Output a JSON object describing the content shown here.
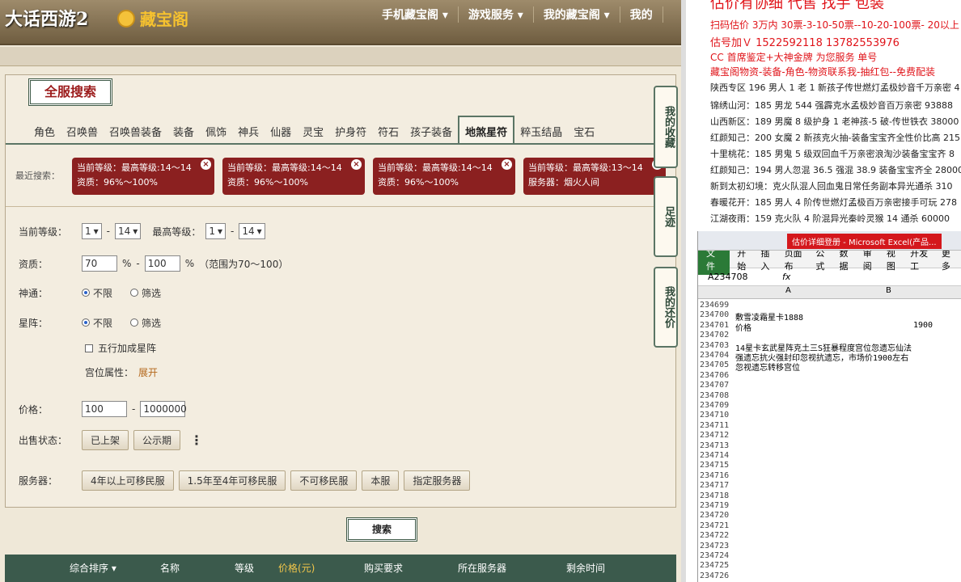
{
  "header": {
    "logo_game": "大话西游2",
    "logo_site": "藏宝阁",
    "nav": [
      "手机藏宝阁 ▾",
      "游戏服务 ▾",
      "我的藏宝阁 ▾",
      "我的"
    ]
  },
  "panel": {
    "title": "全服搜索",
    "tabs": [
      "角色",
      "召唤兽",
      "召唤兽装备",
      "装备",
      "佩饰",
      "神兵",
      "仙器",
      "灵宝",
      "护身符",
      "符石",
      "孩子装备",
      "地煞星符",
      "粹玉结晶",
      "宝石"
    ],
    "recent_label": "最近搜索：",
    "chips": [
      {
        "l1": "当前等级：最高等级:14～14",
        "l2": "资质：96%～100%"
      },
      {
        "l1": "当前等级：最高等级:14～14",
        "l2": "资质：96%～100%"
      },
      {
        "l1": "当前等级：最高等级:14～14",
        "l2": "资质：96%～100%"
      },
      {
        "l1": "当前等级：最高等级:13～14",
        "l2": "服务器：烟火人间"
      }
    ],
    "form": {
      "level_label": "当前等级：",
      "lv_min": "1",
      "lv_max": "14",
      "maxlevel_label": "最高等级：",
      "mlv_min": "1",
      "mlv_max": "14",
      "quality_label": "资质：",
      "q_min": "70",
      "q_max": "100",
      "pct": "%",
      "range_note": "（范围为70～100）",
      "shentong_label": "神通：",
      "xingzhen_label": "星阵：",
      "opt_any": "不限",
      "opt_filter": "筛选",
      "wuxing": "五行加成星阵",
      "gongwei_label": "宫位属性：",
      "expand": "展开",
      "price_label": "价格：",
      "p_min": "100",
      "p_max": "1000000",
      "sale_label": "出售状态：",
      "sale_opts": [
        "已上架",
        "公示期"
      ],
      "server_label": "服务器：",
      "server_opts": [
        "4年以上可移民服",
        "1.5年至4年可移民服",
        "不可移民服",
        "本服",
        "指定服务器"
      ]
    },
    "search": "搜索",
    "table_head": [
      "综合排序 ▾",
      "名称",
      "等级",
      "价格(元)",
      "购买要求",
      "所在服务器",
      "剩余时间"
    ]
  },
  "side_buttons": [
    "我的收藏",
    "足迹",
    "我的还价"
  ],
  "right": {
    "ads": [
      "估价有协细 代售 找手 包装",
      "扫码估价 3万内 30票-3-10-50票--10-20-100票- 20以上 150+",
      "估号加Ｖ 1522592118 13782553976",
      "CC 首席鉴定+大神金牌 为您服务 单号",
      "藏宝阁物资-装备-角色-物资联系我-抽红包--免费配装"
    ],
    "info": [
      "陕西专区 196 男人 1 老 1 新孩子传世燃灯孟极妙音千万亲密 4",
      "锦绣山河：185 男龙 544 强霹克水孟极妙音百万亲密 93888",
      "山西新区：189 男魔 8 级护身 1 老神孩-5 破-传世铁衣 38000",
      "红颜知己：200 女魔 2 新孩克火抽-装备宝宝齐全性价比高 215",
      "十里桃花：185 男鬼 5 级双回血千万亲密浪淘沙装备宝宝齐 8",
      "红颜知己：194 男人忽混 36.5 强混 38.9 装备宝宝齐全 28000",
      "新到太初幻境：克火队混人回血鬼日常任务副本异光通杀 310",
      "春暖花开：185 男人 4 阶传世燃灯孟极百万亲密接手可玩 278",
      "江湖夜雨：159 克火队 4 阶混异光秦岭灵猴 14 通杀 60000"
    ]
  },
  "excel": {
    "title": "估价详细登册 - Microsoft Excel(产品...",
    "tabs": [
      "文件",
      "开始",
      "插入",
      "页面布",
      "公式",
      "数据",
      "审阅",
      "视图",
      "开发工",
      "更多"
    ],
    "cell_ref": "A234708",
    "fx": "fx",
    "col_a": "A",
    "col_b": "B",
    "rows": [
      {
        "n": "234699",
        "a": "",
        "b": ""
      },
      {
        "n": "234700",
        "a": "敷雪凌霜星卡1888",
        "b": ""
      },
      {
        "n": "234701",
        "a": "价格",
        "b": "1900"
      },
      {
        "n": "234702",
        "a": "",
        "b": ""
      },
      {
        "n": "234703",
        "a": "14星卡玄武星阵克土三S狂暴程度宫位忽遗忘仙法",
        "b": ""
      },
      {
        "n": "234704",
        "a": "强遗忘抗火强封印忽视抗遗忘，市场价1900左右",
        "b": ""
      },
      {
        "n": "234705",
        "a": "忽视遗忘转移宫位",
        "b": ""
      },
      {
        "n": "234706",
        "a": "",
        "b": ""
      },
      {
        "n": "234707",
        "a": "",
        "b": ""
      },
      {
        "n": "234708",
        "a": "",
        "b": ""
      },
      {
        "n": "234709",
        "a": "",
        "b": ""
      },
      {
        "n": "234710",
        "a": "",
        "b": ""
      },
      {
        "n": "234711",
        "a": "",
        "b": ""
      },
      {
        "n": "234712",
        "a": "",
        "b": ""
      },
      {
        "n": "234713",
        "a": "",
        "b": ""
      },
      {
        "n": "234714",
        "a": "",
        "b": ""
      },
      {
        "n": "234715",
        "a": "",
        "b": ""
      },
      {
        "n": "234716",
        "a": "",
        "b": ""
      },
      {
        "n": "234717",
        "a": "",
        "b": ""
      },
      {
        "n": "234718",
        "a": "",
        "b": ""
      },
      {
        "n": "234719",
        "a": "",
        "b": ""
      },
      {
        "n": "234720",
        "a": "",
        "b": ""
      },
      {
        "n": "234721",
        "a": "",
        "b": ""
      },
      {
        "n": "234722",
        "a": "",
        "b": ""
      },
      {
        "n": "234723",
        "a": "",
        "b": ""
      },
      {
        "n": "234724",
        "a": "",
        "b": ""
      },
      {
        "n": "234725",
        "a": "",
        "b": ""
      },
      {
        "n": "234726",
        "a": "",
        "b": ""
      }
    ]
  }
}
